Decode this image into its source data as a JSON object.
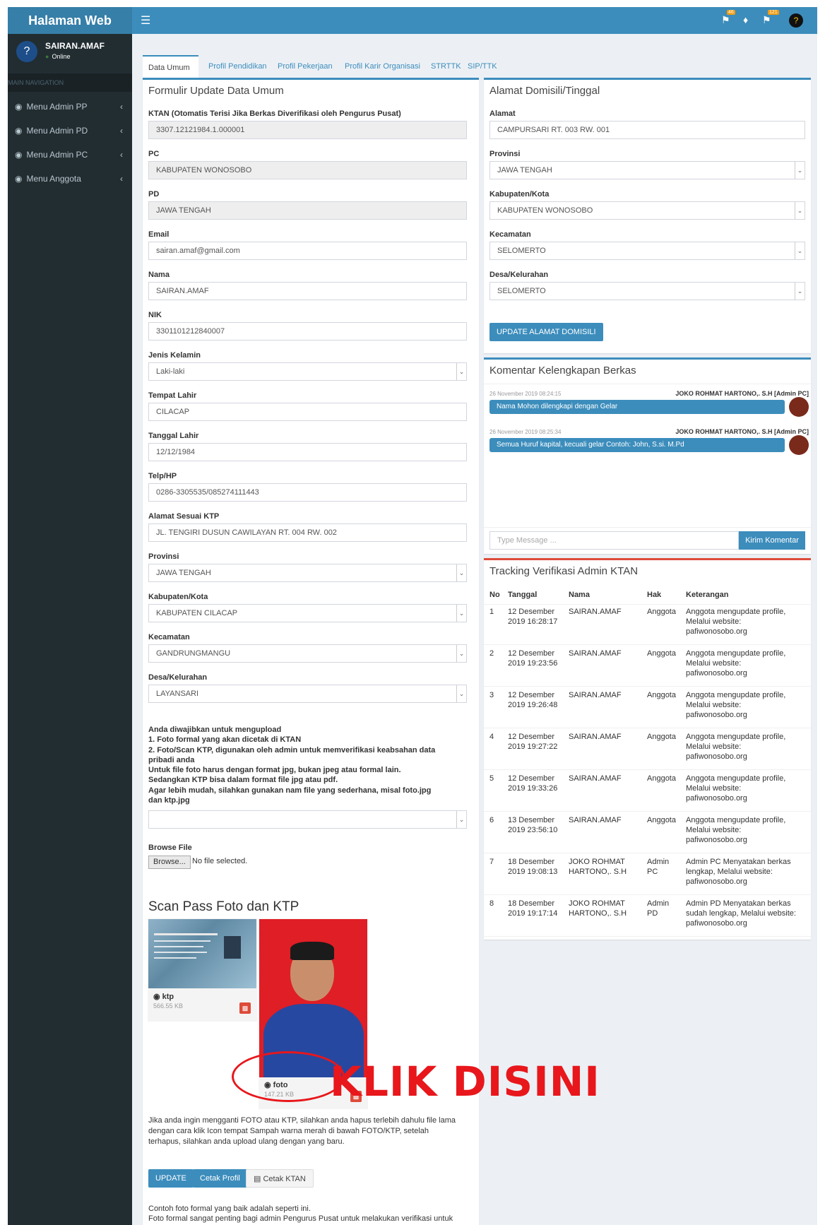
{
  "app": {
    "title": "Halaman Web"
  },
  "topbar": {
    "menu_icon": "hamburger-icon",
    "badge1": "46",
    "badge2": "",
    "badge3": "121"
  },
  "user": {
    "name": "SAIRAN.AMAF",
    "status": "Online"
  },
  "sidebar": {
    "header": "MAIN NAVIGATION",
    "items": [
      {
        "label": "Menu Admin PP"
      },
      {
        "label": "Menu Admin PD"
      },
      {
        "label": "Menu Admin PC"
      },
      {
        "label": "Menu Anggota"
      }
    ]
  },
  "tabs": [
    "Data Umum",
    "Profil Pendidikan",
    "Profil Pekerjaan",
    "Profil Karir Organisasi",
    "STRTTK",
    "SIP/TTK"
  ],
  "form": {
    "title": "Formulir Update Data Umum",
    "fields": {
      "ktan": {
        "label": "KTAN (Otomatis Terisi Jika Berkas Diverifikasi oleh Pengurus Pusat)",
        "value": "3307.12121984.1.000001"
      },
      "pc": {
        "label": "PC",
        "value": "KABUPATEN WONOSOBO"
      },
      "pd": {
        "label": "PD",
        "value": "JAWA TENGAH"
      },
      "email": {
        "label": "Email",
        "value": "sairan.amaf@gmail.com"
      },
      "nama": {
        "label": "Nama",
        "value": "SAIRAN.AMAF"
      },
      "nik": {
        "label": "NIK",
        "value": "3301101212840007"
      },
      "jenis_kelamin": {
        "label": "Jenis Kelamin",
        "value": "Laki-laki"
      },
      "tempat_lahir": {
        "label": "Tempat Lahir",
        "value": "CILACAP"
      },
      "tanggal_lahir": {
        "label": "Tanggal Lahir",
        "value": "12/12/1984"
      },
      "telp": {
        "label": "Telp/HP",
        "value": "0286-3305535/085274111443"
      },
      "alamat_ktp": {
        "label": "Alamat Sesuai KTP",
        "value": "JL. TENGIRI DUSUN CAWILAYAN RT. 004 RW. 002"
      },
      "provinsi": {
        "label": "Provinsi",
        "value": "JAWA TENGAH"
      },
      "kabupaten": {
        "label": "Kabupaten/Kota",
        "value": "KABUPATEN CILACAP"
      },
      "kecamatan": {
        "label": "Kecamatan",
        "value": "GANDRUNGMANGU"
      },
      "desa": {
        "label": "Desa/Kelurahan",
        "value": "LAYANSARI"
      }
    },
    "upload_note": [
      "Anda diwajibkan untuk mengupload",
      "1. Foto formal yang akan dicetak di KTAN",
      "2. Foto/Scan KTP, digunakan oleh admin untuk memverifikasi keabsahan data",
      "pribadi anda",
      "Untuk file foto harus dengan format jpg, bukan jpeg atau formal lain.",
      "Sedangkan KTP bisa dalam format file jpg atau pdf.",
      "Agar lebih mudah, silahkan gunakan nam file yang sederhana, misal foto.jpg",
      "dan ktp.jpg"
    ],
    "browse_label": "Browse File",
    "browse_button": "Browse...",
    "browse_status": "No file selected.",
    "scan_title": "Scan Pass Foto dan KTP",
    "files": [
      {
        "name": "ktp",
        "size": "566.55 KB"
      },
      {
        "name": "foto",
        "size": "147.21 KB"
      }
    ],
    "replace_note": [
      "Jika anda ingin mengganti FOTO atau KTP, silahkan anda hapus terlebih dahulu file lama",
      "dengan cara klik Icon tempat Sampah warna merah di bawah FOTO/KTP, setelah",
      "terhapus, silahkan anda upload ulang dengan yang baru."
    ],
    "buttons": {
      "update": "UPDATE",
      "cetak_profil": "Cetak Profil",
      "cetak_ktan": "Cetak KTAN"
    },
    "footer_note": [
      "Contoh foto formal yang baik adalah seperti ini.",
      "Foto formal sangat penting bagi admin Pengurus Pusat untuk melakukan verifikasi untuk"
    ]
  },
  "domisili": {
    "title": "Alamat Domisili/Tinggal",
    "alamat": {
      "label": "Alamat",
      "value": "CAMPURSARI RT. 003 RW. 001"
    },
    "provinsi": {
      "label": "Provinsi",
      "value": "JAWA TENGAH"
    },
    "kabupaten": {
      "label": "Kabupaten/Kota",
      "value": "KABUPATEN WONOSOBO"
    },
    "kecamatan": {
      "label": "Kecamatan",
      "value": "SELOMERTO"
    },
    "desa": {
      "label": "Desa/Kelurahan",
      "value": "SELOMERTO"
    },
    "button": "UPDATE ALAMAT DOMISILI"
  },
  "komentar": {
    "title": "Komentar Kelengkapan Berkas",
    "messages": [
      {
        "time": "26 November 2019 08:24:15",
        "author": "JOKO ROHMAT HARTONO,. S.H [Admin PC]",
        "text": "Nama Mohon dilengkapi dengan Gelar"
      },
      {
        "time": "26 November 2019 08:25:34",
        "author": "JOKO ROHMAT HARTONO,. S.H [Admin PC]",
        "text": "Semua Huruf kapital, kecuali gelar Contoh: John, S.si. M.Pd"
      }
    ],
    "placeholder": "Type Message ...",
    "send": "Kirim Komentar"
  },
  "tracking": {
    "title": "Tracking Verifikasi Admin KTAN",
    "headers": [
      "No",
      "Tanggal",
      "Nama",
      "Hak",
      "Keterangan"
    ],
    "rows": [
      {
        "no": "1",
        "tanggal": [
          "12 Desember",
          "2019 16:28:17"
        ],
        "nama": [
          "SAIRAN.AMAF",
          ""
        ],
        "hak": [
          "Anggota",
          ""
        ],
        "ket": [
          "Anggota mengupdate profile,",
          "Melalui website:",
          "pafiwonosobo.org"
        ]
      },
      {
        "no": "2",
        "tanggal": [
          "12 Desember",
          "2019 19:23:56"
        ],
        "nama": [
          "SAIRAN.AMAF",
          ""
        ],
        "hak": [
          "Anggota",
          ""
        ],
        "ket": [
          "Anggota mengupdate profile,",
          "Melalui website:",
          "pafiwonosobo.org"
        ]
      },
      {
        "no": "3",
        "tanggal": [
          "12 Desember",
          "2019 19:26:48"
        ],
        "nama": [
          "SAIRAN.AMAF",
          ""
        ],
        "hak": [
          "Anggota",
          ""
        ],
        "ket": [
          "Anggota mengupdate profile,",
          "Melalui website:",
          "pafiwonosobo.org"
        ]
      },
      {
        "no": "4",
        "tanggal": [
          "12 Desember",
          "2019 19:27:22"
        ],
        "nama": [
          "SAIRAN.AMAF",
          ""
        ],
        "hak": [
          "Anggota",
          ""
        ],
        "ket": [
          "Anggota mengupdate profile,",
          "Melalui website:",
          "pafiwonosobo.org"
        ]
      },
      {
        "no": "5",
        "tanggal": [
          "12 Desember",
          "2019 19:33:26"
        ],
        "nama": [
          "SAIRAN.AMAF",
          ""
        ],
        "hak": [
          "Anggota",
          ""
        ],
        "ket": [
          "Anggota mengupdate profile,",
          "Melalui website:",
          "pafiwonosobo.org"
        ]
      },
      {
        "no": "6",
        "tanggal": [
          "13 Desember",
          "2019 23:56:10"
        ],
        "nama": [
          "SAIRAN.AMAF",
          ""
        ],
        "hak": [
          "Anggota",
          ""
        ],
        "ket": [
          "Anggota mengupdate profile,",
          "Melalui website:",
          "pafiwonosobo.org"
        ]
      },
      {
        "no": "7",
        "tanggal": [
          "18 Desember",
          "2019 19:08:13"
        ],
        "nama": [
          "JOKO ROHMAT",
          "HARTONO,. S.H"
        ],
        "hak": [
          "Admin",
          "PC"
        ],
        "ket": [
          "Admin PC Menyatakan berkas",
          "lengkap, Melalui website:",
          "pafiwonosobo.org"
        ]
      },
      {
        "no": "8",
        "tanggal": [
          "18 Desember",
          "2019 19:17:14"
        ],
        "nama": [
          "JOKO ROHMAT",
          "HARTONO,. S.H"
        ],
        "hak": [
          "Admin",
          "PD"
        ],
        "ket": [
          "Admin PD Menyatakan berkas",
          "sudah lengkap, Melalui website:",
          "pafiwonosobo.org"
        ]
      }
    ]
  },
  "overlay": {
    "text": "KLIK DISINI",
    "color": "#e8171b"
  },
  "colors": {
    "primary": "#3c8dbc",
    "sidebar": "#222d32",
    "danger": "#dd4b39"
  }
}
